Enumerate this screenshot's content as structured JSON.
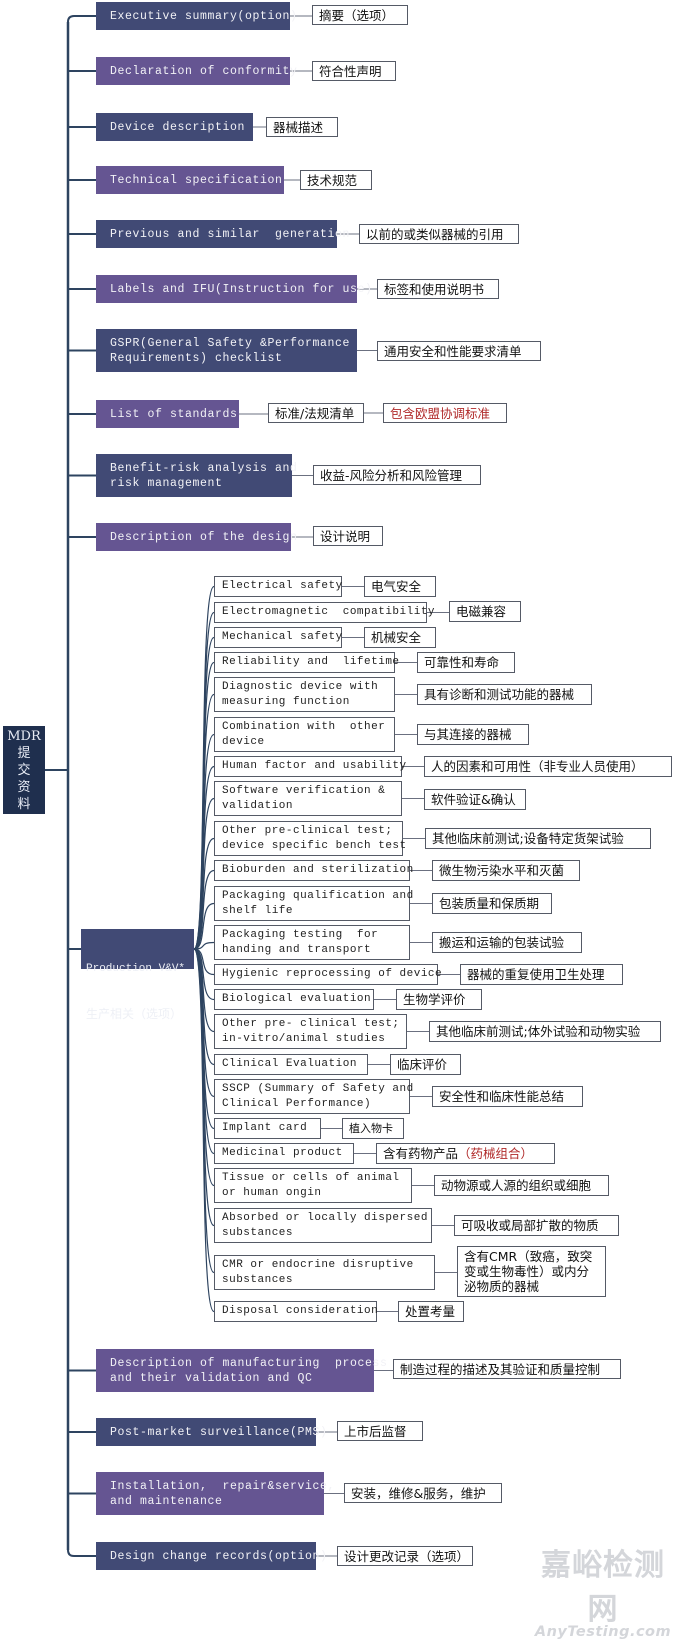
{
  "root": {
    "label_en": "MDR",
    "label_cn_chars": [
      "提",
      "交",
      "资",
      "料"
    ]
  },
  "colors": {
    "dark_node": "#414a75",
    "purple_node": "#655592",
    "root_node": "#1f2f4e",
    "connector": "#2e4460",
    "highlight_red": "#b02a2a"
  },
  "main_items": [
    {
      "en": "Executive summary(option)",
      "cn": "摘要（选项）"
    },
    {
      "en": "Declaration of conformity",
      "cn": "符合性声明"
    },
    {
      "en": "Device description",
      "cn": "器械描述"
    },
    {
      "en": "Technical specification",
      "cn": "技术规范"
    },
    {
      "en": "Previous and similar  generation",
      "cn": "以前的或类似器械的引用"
    },
    {
      "en": "Labels and IFU(Instruction for use)",
      "cn": "标签和使用说明书"
    },
    {
      "en": "GSPR(General Safety &Performance\nRequirements) checklist",
      "cn": "通用安全和性能要求清单"
    },
    {
      "en": "List of standards",
      "cn": "标准/法规清单",
      "cn_extra": "包含欧盟协调标准"
    },
    {
      "en": "Benefit-risk analysis and\nrisk management",
      "cn": "收益-风险分析和风险管理"
    },
    {
      "en": "Description of the design",
      "cn": "设计说明"
    },
    {
      "en": "Description of manufacturing  process\nand their validation and QC",
      "cn": "制造过程的描述及其验证和质量控制"
    },
    {
      "en": "Post-market surveillance(PMS)",
      "cn": "上市后监督"
    },
    {
      "en": "Installation,  repair&service,\nand maintenance",
      "cn": "安装，维修&服务，维护"
    },
    {
      "en": "Design change records(option)",
      "cn": "设计更改记录（选项）"
    }
  ],
  "production": {
    "label_en": "Production V&V*",
    "label_cn": "生产相关（选项）",
    "children": [
      {
        "en": "Electrical safety",
        "cn": "电气安全"
      },
      {
        "en": "Electromagnetic  compatibility",
        "cn": "电磁兼容"
      },
      {
        "en": "Mechanical safety",
        "cn": "机械安全"
      },
      {
        "en": "Reliability and  lifetime",
        "cn": "可靠性和寿命"
      },
      {
        "en": "Diagnostic device with\nmeasuring function",
        "cn": "具有诊断和测试功能的器械"
      },
      {
        "en": "Combination with  other\ndevice",
        "cn": "与其连接的器械"
      },
      {
        "en": "Human factor and usability",
        "cn": "人的因素和可用性（非专业人员使用）"
      },
      {
        "en": "Software verification &\nvalidation",
        "cn": "软件验证&确认"
      },
      {
        "en": "Other pre-clinical test;\ndevice specific bench test",
        "cn": "其他临床前测试;设备特定货架试验"
      },
      {
        "en": "Bioburden and sterilization",
        "cn": "微生物污染水平和灭菌"
      },
      {
        "en": "Packaging qualification and\nshelf life",
        "cn": "包装质量和保质期"
      },
      {
        "en": "Packaging testing  for\nhanding and transport",
        "cn": "搬运和运输的包装试验"
      },
      {
        "en": "Hygienic reprocessing of device",
        "cn": "器械的重复使用卫生处理"
      },
      {
        "en": "Biological evaluation",
        "cn": "生物学评价"
      },
      {
        "en": "Other pre- clinical test;\nin-vitro/animal studies",
        "cn": "其他临床前测试;体外试验和动物实验"
      },
      {
        "en": "Clinical Evaluation",
        "cn": "临床评价"
      },
      {
        "en": "SSCP (Summary of Safety and\nClinical Performance)",
        "cn": "安全性和临床性能总结"
      },
      {
        "en": "Implant card",
        "cn": "植入物卡"
      },
      {
        "en": "Medicinal product",
        "cn": "含有药物产品",
        "cn_red": "（药械组合）"
      },
      {
        "en": "Tissue or cells of animal\nor human ongin",
        "cn": "动物源或人源的组织或细胞"
      },
      {
        "en": "Absorbed or locally dispersed\nsubstances",
        "cn": "可吸收或局部扩散的物质"
      },
      {
        "en": "CMR or endocrine disruptive\nsubstances",
        "cn": "含有CMR（致癌，致突\n变或生物毒性）或内分\n泌物质的器械"
      },
      {
        "en": "Disposal consideration",
        "cn": "处置考量"
      }
    ]
  },
  "watermark": {
    "cn": "嘉峪检测网",
    "en": "AnyTesting.com"
  }
}
